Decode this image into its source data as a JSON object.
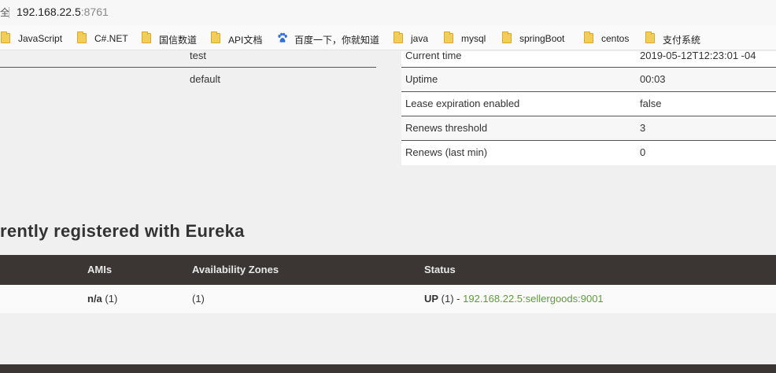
{
  "browser": {
    "security_label": "全",
    "url_host": "192.168.22.5",
    "url_port": ":8761"
  },
  "bookmarks": [
    {
      "label": "JavaScript",
      "icon": "folder-icon"
    },
    {
      "label": "C#.NET",
      "icon": "folder-icon"
    },
    {
      "label": "国信数道",
      "icon": "folder-icon"
    },
    {
      "label": "API文档",
      "icon": "folder-icon"
    },
    {
      "label": "百度一下，你就知道",
      "icon": "baidu-paw-icon"
    },
    {
      "label": "java",
      "icon": "folder-icon"
    },
    {
      "label": "mysql",
      "icon": "folder-icon"
    },
    {
      "label": "springBoot",
      "icon": "folder-icon"
    },
    {
      "label": "centos",
      "icon": "folder-icon"
    },
    {
      "label": "支付系统",
      "icon": "folder-icon"
    }
  ],
  "system_status_left": {
    "rows": [
      "test",
      "default"
    ]
  },
  "system_status_right": {
    "rows": [
      {
        "key": "Current time",
        "value": "2019-05-12T12:23:01 -04"
      },
      {
        "key": "Uptime",
        "value": "00:03"
      },
      {
        "key": "Lease expiration enabled",
        "value": "false"
      },
      {
        "key": "Renews threshold",
        "value": "3"
      },
      {
        "key": "Renews (last min)",
        "value": "0"
      }
    ]
  },
  "instances_section": {
    "title": "rently registered with Eureka",
    "columns": [
      "AMIs",
      "Availability Zones",
      "Status"
    ],
    "rows": [
      {
        "amis_bold": "n/a",
        "amis_count": " (1)",
        "zones": "(1)",
        "status_bold": "UP",
        "status_count": " (1) - ",
        "status_link": "192.168.22.5:sellergoods:9001"
      }
    ]
  },
  "colors": {
    "table_header_bg": "#3b3634",
    "link_green": "#5f9b3a"
  }
}
